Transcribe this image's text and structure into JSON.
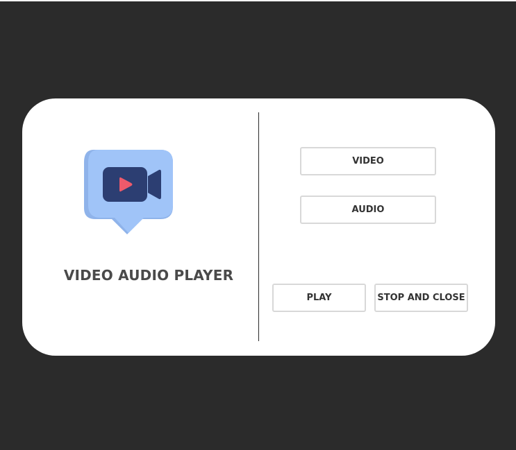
{
  "window": {
    "background_color": "#2b2b2b",
    "card_color": "#ffffff"
  },
  "logo": {
    "icon": "video-camera-chat-bubble-icon",
    "bubble_color": "#a0c4f8",
    "camera_color": "#2c3e72",
    "play_color": "#ee5a6b"
  },
  "app": {
    "title": "VIDEO AUDIO PLAYER"
  },
  "buttons": {
    "video": "VIDEO",
    "audio": "AUDIO",
    "play": "PLAY",
    "stop_and_close": "STOP AND CLOSE"
  }
}
